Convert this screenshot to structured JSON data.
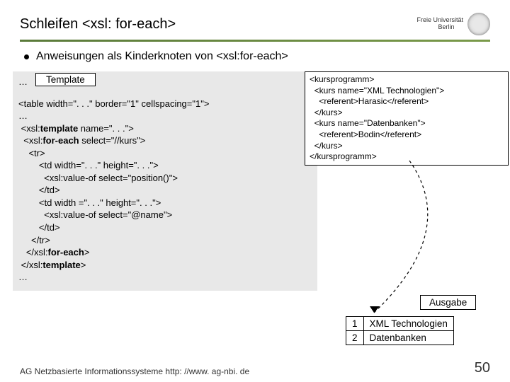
{
  "title": "Schleifen <xsl: for-each>",
  "logo": {
    "line1": "Freie Universität",
    "line2": "Berlin"
  },
  "bullet": "Anweisungen als Kinderknoten von <xsl:for-each>",
  "template_label": "Template",
  "code": {
    "l1": "…",
    "l2": "<table width=\". . .\" border=\"1\" cellspacing=\"1\">",
    "l3": "…",
    "l4a": " <xsl:",
    "l4b": "template",
    "l4c": " name=\". . .\">",
    "l5a": "  <xsl:",
    "l5b": "for-each",
    "l5c": " select=\"//kurs\">",
    "l6": "    <tr>",
    "l7": "        <td width=\". . .\" height=\". . .\">",
    "l8": "          <xsl:value-of select=\"position()\">",
    "l9": "        </td>",
    "l10": "        <td width =\". . .\" height=\". . .\">",
    "l11": "          <xsl:value-of select=\"@name\">",
    "l12": "        </td>",
    "l13": "     </tr>",
    "l14a": "   </xsl:",
    "l14b": "for-each",
    "l14c": ">",
    "l15a": " </xsl:",
    "l15b": "template",
    "l15c": ">",
    "l16": "…"
  },
  "xml": {
    "l1": "<kursprogramm>",
    "l2": "  <kurs name=\"XML Technologien\">",
    "l3": "    <referent>Harasic</referent>",
    "l4": "  </kurs>",
    "l5": "  <kurs name=\"Datenbanken\">",
    "l6": "    <referent>Bodin</referent>",
    "l7": "  </kurs>",
    "l8": "</kursprogramm>"
  },
  "ausgabe_label": "Ausgabe",
  "output": {
    "r1c1": "1",
    "r1c2": "XML Technologien",
    "r2c1": "2",
    "r2c2": "Datenbanken"
  },
  "footer": {
    "left": "AG Netzbasierte Informationssysteme http: //www. ag-nbi. de",
    "page": "50"
  }
}
